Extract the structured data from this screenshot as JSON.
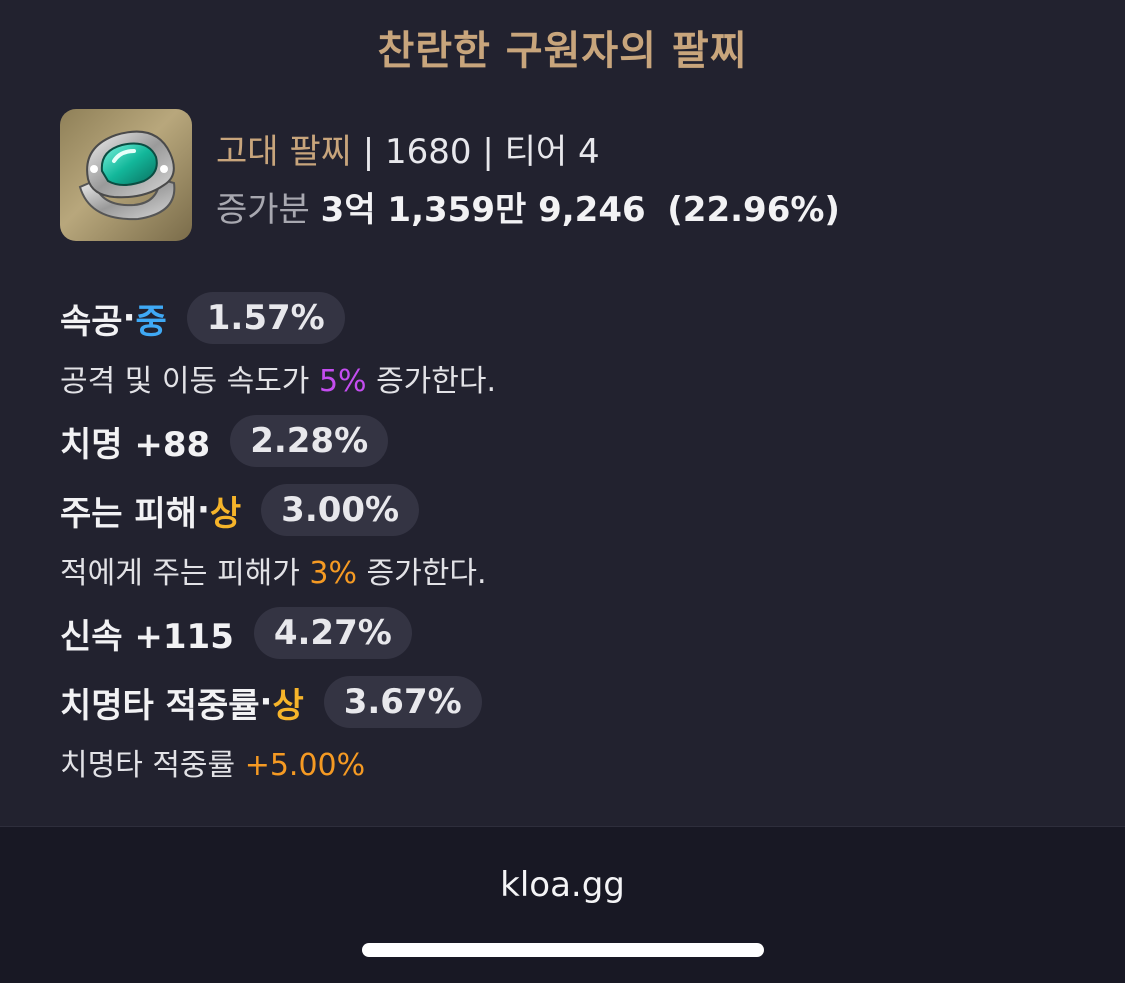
{
  "item": {
    "name": "찬란한 구원자의 팔찌",
    "icon": "bracelet-gem-icon",
    "type": "고대 팔찌",
    "sep1": " | ",
    "item_level": "1680",
    "sep2": " | ",
    "tier": "티어 4",
    "gain_label": "증가분",
    "gain_value": "3억 1,359만 9,246",
    "gain_percent": "(22.96%)"
  },
  "options": [
    {
      "name": "속공",
      "dot": " · ",
      "grade": "중",
      "percent": "1.57%",
      "desc_before": "공격 및 이동 속도가 ",
      "desc_value": "5%",
      "desc_after": " 증가한다."
    },
    {
      "name": "치명 +88",
      "percent": "2.28%"
    },
    {
      "name": "주는 피해",
      "dot": " · ",
      "grade": "상",
      "percent": "3.00%",
      "desc_before": "적에게 주는 피해가 ",
      "desc_value": "3%",
      "desc_after": " 증가한다."
    },
    {
      "name": "신속 +115",
      "percent": "4.27%"
    },
    {
      "name": "치명타 적중률",
      "dot": " · ",
      "grade": "상",
      "percent": "3.67%",
      "desc_before": "치명타 적중률 ",
      "desc_value": "+5.00%",
      "desc_after": ""
    }
  ],
  "footer": {
    "brand": "kloa.gg"
  },
  "colors": {
    "title_gold": "#c8a57c",
    "grade_mid": "#3fa9f5",
    "grade_high": "#f6b42a",
    "value_purple": "#c44df0",
    "value_orange": "#f59a23",
    "background": "#22222f"
  }
}
